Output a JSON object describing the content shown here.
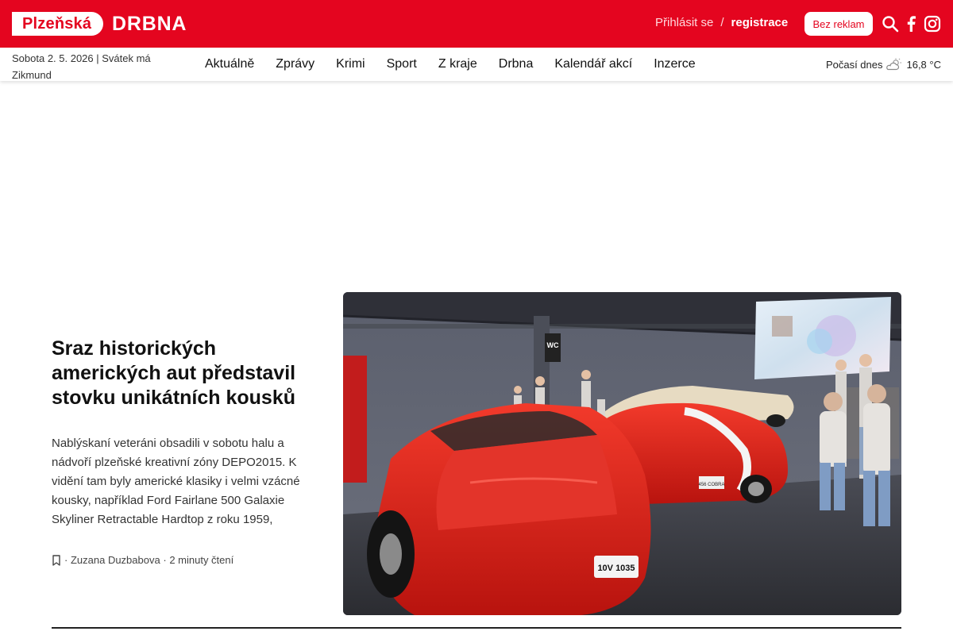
{
  "header": {
    "logo_pill": "Plzeňská",
    "logo_word": "DRBNA",
    "login_label": "Přihlásit se",
    "separator": "/",
    "register_label": "registrace",
    "adfree_label": "Bez reklam",
    "icons": [
      "search-icon",
      "facebook-icon",
      "instagram-icon"
    ],
    "brand_color": "#e4051f"
  },
  "subheader": {
    "date_line": "Sobota 2. 5. 2026  |  Svátek má Zikmund",
    "nav": [
      "Aktuálně",
      "Zprávy",
      "Krimi",
      "Sport",
      "Z kraje",
      "Drbna",
      "Kalendář akcí",
      "Inzerce"
    ],
    "weather_label": "Počasí dnes",
    "weather_icon": "partly-cloudy-icon",
    "temperature": "16,8 °C"
  },
  "article": {
    "title": "Sraz historických amerických aut představil stovku unikátních kousků",
    "perex": "Nablýskaní veteráni obsadili v sobotu halu a nádvoří plzeňské kreativní zóny DEPO2015. K vidění tam byly americké klasiky i velmi vzácné kousky, například Ford Fairlane 500 Galaxie Skyliner Retractable Hardtop z roku 1959,",
    "meta_sep": "·",
    "author": "Zuzana Duzbabova",
    "reading_time": "2 minuty čtení",
    "bookmark_icon": "bookmark-icon",
    "image": {
      "sign": "WC",
      "plate_front": "10V 1035",
      "plate_cobra": "456 COBRA"
    }
  }
}
